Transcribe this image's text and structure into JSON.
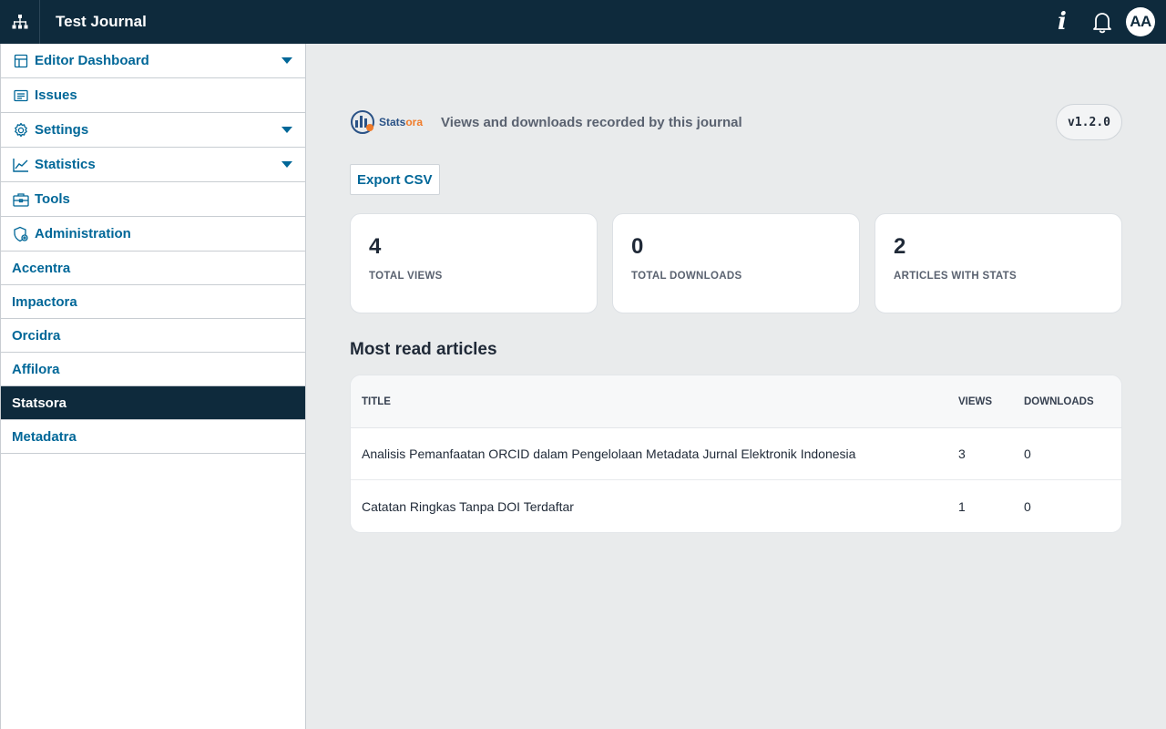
{
  "topbar": {
    "site_title": "Test Journal",
    "avatar_initials": "AA",
    "icons": [
      "sitemap-icon",
      "info-icon",
      "bell-icon"
    ]
  },
  "sidebar": {
    "items": [
      {
        "label": "Editor Dashboard",
        "icon": "dashboard-icon",
        "expandable": true
      },
      {
        "label": "Issues",
        "icon": "issues-icon",
        "expandable": false
      },
      {
        "label": "Settings",
        "icon": "gear-icon",
        "expandable": true
      },
      {
        "label": "Statistics",
        "icon": "chart-line-icon",
        "expandable": true
      },
      {
        "label": "Tools",
        "icon": "toolbox-icon",
        "expandable": false
      },
      {
        "label": "Administration",
        "icon": "admin-shield-icon",
        "expandable": false
      },
      {
        "label": "Accentra"
      },
      {
        "label": "Impactora"
      },
      {
        "label": "Orcidra"
      },
      {
        "label": "Affilora"
      },
      {
        "label": "Statsora",
        "active": true
      },
      {
        "label": "Metadatra"
      }
    ]
  },
  "main": {
    "logo_text_a": "Stats",
    "logo_text_b": "ora",
    "subtitle": "Views and downloads recorded by this journal",
    "version": "v1.2.0",
    "export_label": "Export CSV",
    "cards": [
      {
        "value": "4",
        "label": "TOTAL VIEWS"
      },
      {
        "value": "0",
        "label": "TOTAL DOWNLOADS"
      },
      {
        "value": "2",
        "label": "ARTICLES WITH STATS"
      }
    ],
    "section_title": "Most read articles",
    "table": {
      "headers": {
        "title": "TITLE",
        "views": "VIEWS",
        "downloads": "DOWNLOADS"
      },
      "rows": [
        {
          "title": "Analisis Pemanfaatan ORCID dalam Pengelolaan Metadata Jurnal Elektronik Indonesia",
          "views": "3",
          "downloads": "0"
        },
        {
          "title": "Catatan Ringkas Tanpa DOI Terdaftar",
          "views": "1",
          "downloads": "0"
        }
      ]
    }
  },
  "colors": {
    "topbar": "#0e2a3c",
    "link": "#006798",
    "background": "#e9ebec",
    "logo_orange": "#f07c2b"
  }
}
